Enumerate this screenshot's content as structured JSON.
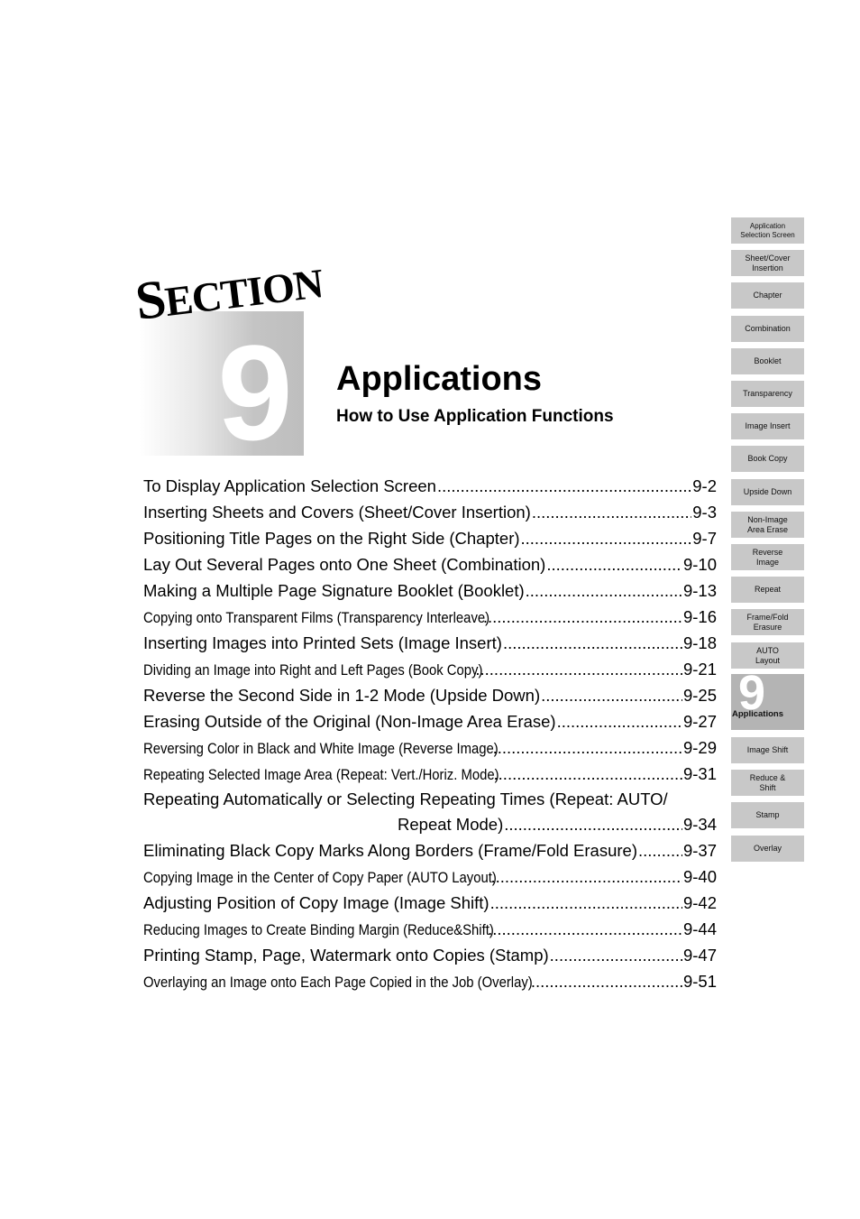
{
  "header": {
    "section_word_cap": "S",
    "section_word_rest": "ECTION",
    "section_number": "9",
    "title": "Applications",
    "subtitle": "How to Use Application Functions"
  },
  "toc": [
    {
      "text": "To Display Application Selection Screen",
      "page": "9-2",
      "narrow": false
    },
    {
      "text": "Inserting Sheets and Covers (Sheet/Cover Insertion)",
      "page": "9-3",
      "narrow": false
    },
    {
      "text": "Positioning Title Pages on the Right Side (Chapter)",
      "page": "9-7",
      "narrow": false
    },
    {
      "text": "Lay Out Several Pages onto One Sheet (Combination)",
      "page": "9-10",
      "narrow": false
    },
    {
      "text": "Making a Multiple Page Signature Booklet (Booklet)",
      "page": "9-13",
      "narrow": false
    },
    {
      "text": "Copying onto Transparent Films (Transparency Interleave)",
      "page": "9-16",
      "narrow": true
    },
    {
      "text": "Inserting Images into Printed Sets (Image Insert)",
      "page": "9-18",
      "narrow": false
    },
    {
      "text": "Dividing an Image into Right and Left Pages (Book Copy)",
      "page": "9-21",
      "narrow": true
    },
    {
      "text": "Reverse the Second Side in 1-2 Mode (Upside Down)",
      "page": "9-25",
      "narrow": false
    },
    {
      "text": "Erasing Outside of the Original (Non-Image Area Erase)",
      "page": "9-27",
      "narrow": false
    },
    {
      "text": "Reversing Color in Black and White Image (Reverse Image)",
      "page": "9-29",
      "narrow": true
    },
    {
      "text": "Repeating Selected Image Area (Repeat: Vert./Horiz. Mode)",
      "page": "9-31",
      "narrow": true
    },
    {
      "text": "Repeating Automatically or Selecting Repeating Times (Repeat: AUTO/",
      "continuation": "Repeat Mode)",
      "page": "9-34",
      "narrow": false
    },
    {
      "text": "Eliminating Black Copy Marks Along Borders (Frame/Fold Erasure)",
      "page": "9-37",
      "narrow": false
    },
    {
      "text": "Copying Image in the Center of Copy Paper (AUTO Layout)",
      "page": "9-40",
      "narrow": true
    },
    {
      "text": "Adjusting Position of Copy Image (Image Shift)",
      "page": "9-42",
      "narrow": false
    },
    {
      "text": "Reducing Images to Create Binding Margin (Reduce&Shift)",
      "page": "9-44",
      "narrow": true
    },
    {
      "text": "Printing Stamp, Page, Watermark onto Copies (Stamp)",
      "page": "9-47",
      "narrow": false
    },
    {
      "text": "Overlaying an Image onto Each Page Copied in the Job (Overlay)",
      "page": "9-51",
      "narrow": true
    }
  ],
  "tabs": [
    {
      "label": "Application Selection Screen",
      "lines": [
        "Application",
        "Selection Screen"
      ],
      "small": true
    },
    {
      "label": "Sheet/Cover Insertion",
      "lines": [
        "Sheet/Cover",
        "Insertion"
      ]
    },
    {
      "label": "Chapter",
      "lines": [
        "Chapter"
      ]
    },
    {
      "label": "Combination",
      "lines": [
        "Combination"
      ]
    },
    {
      "label": "Booklet",
      "lines": [
        "Booklet"
      ]
    },
    {
      "label": "Transparency",
      "lines": [
        "Transparency"
      ]
    },
    {
      "label": "Image Insert",
      "lines": [
        "Image Insert"
      ]
    },
    {
      "label": "Book Copy",
      "lines": [
        "Book Copy"
      ]
    },
    {
      "label": "Upside Down",
      "lines": [
        "Upside Down"
      ]
    },
    {
      "label": "Non-Image Area Erase",
      "lines": [
        "Non-Image",
        "Area Erase"
      ]
    },
    {
      "label": "Reverse Image",
      "lines": [
        "Reverse",
        "Image"
      ]
    },
    {
      "label": "Repeat",
      "lines": [
        "Repeat"
      ]
    },
    {
      "label": "Frame/Fold Erasure",
      "lines": [
        "Frame/Fold",
        "Erasure"
      ]
    },
    {
      "label": "AUTO Layout",
      "lines": [
        "AUTO",
        "Layout"
      ]
    },
    {
      "label": "Applications",
      "number": "9",
      "active": true
    },
    {
      "label": "Image Shift",
      "lines": [
        "Image Shift"
      ]
    },
    {
      "label": "Reduce & Shift",
      "lines": [
        "Reduce &",
        "Shift"
      ]
    },
    {
      "label": "Stamp",
      "lines": [
        "Stamp"
      ]
    },
    {
      "label": "Overlay",
      "lines": [
        "Overlay"
      ]
    }
  ],
  "colors": {
    "tab": "#c8c8c8",
    "tab_active": "#b4b4b4",
    "block_gray": "#bebebe"
  }
}
